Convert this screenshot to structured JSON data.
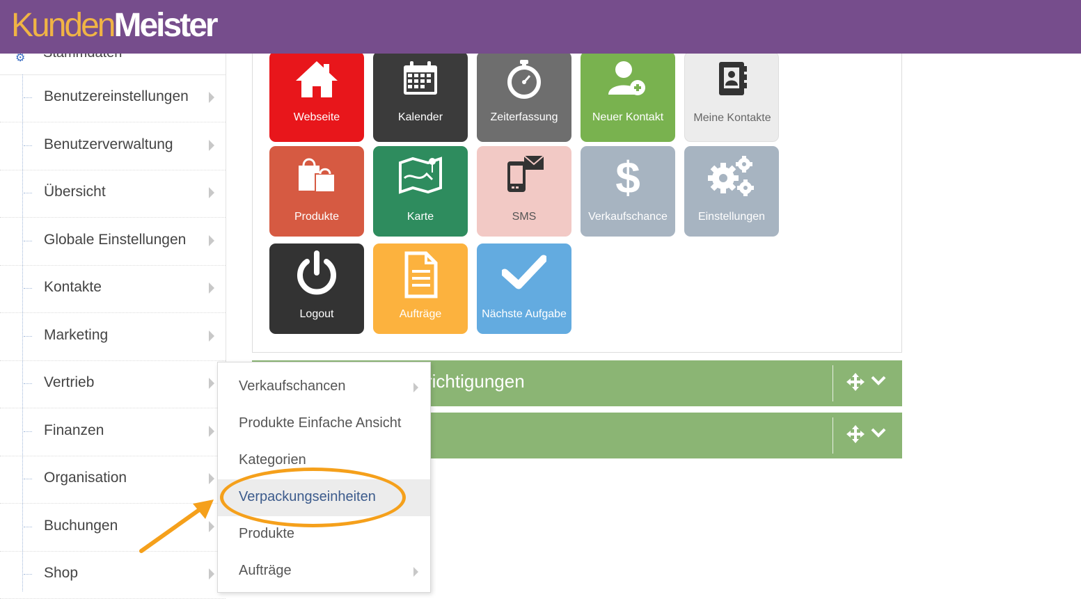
{
  "header": {
    "logo_part1": "Kunden",
    "logo_part2": "Meister",
    "background": "#764d8c",
    "logo_accent": "#f0b445"
  },
  "sidebar": {
    "stub_icon": "gears-icon",
    "stub_label": "Stammdaten",
    "items": [
      {
        "label": "Benutzereinstellungen",
        "has_submenu": true
      },
      {
        "label": "Benutzerverwaltung",
        "has_submenu": true
      },
      {
        "label": "Übersicht",
        "has_submenu": true
      },
      {
        "label": "Globale Einstellungen",
        "has_submenu": true
      },
      {
        "label": "Kontakte",
        "has_submenu": true
      },
      {
        "label": "Marketing",
        "has_submenu": true
      },
      {
        "label": "Vertrieb",
        "has_submenu": true
      },
      {
        "label": "Finanzen",
        "has_submenu": true
      },
      {
        "label": "Organisation",
        "has_submenu": true
      },
      {
        "label": "Buchungen",
        "has_submenu": true
      },
      {
        "label": "Shop",
        "has_submenu": true
      }
    ]
  },
  "tiles": [
    {
      "label": "Webseite",
      "icon": "home-icon",
      "color": "#e8161b"
    },
    {
      "label": "Kalender",
      "icon": "calendar-icon",
      "color": "#3b3b3b"
    },
    {
      "label": "Zeiterfassung",
      "icon": "stopwatch-icon",
      "color": "#6e6e6e"
    },
    {
      "label": "Neuer Kontakt",
      "icon": "add-user-icon",
      "color": "#79b24f"
    },
    {
      "label": "Meine Kontakte",
      "icon": "address-book-icon",
      "color": "#ececec"
    },
    {
      "label": "Produkte",
      "icon": "shopping-bags-icon",
      "color": "#d65a42"
    },
    {
      "label": "Karte",
      "icon": "map-icon",
      "color": "#2e8c5e"
    },
    {
      "label": "SMS",
      "icon": "phone-message-icon",
      "color": "#f2c9c5"
    },
    {
      "label": "Verkaufschance",
      "icon": "dollar-icon",
      "color": "#a7b4c1"
    },
    {
      "label": "Einstellungen",
      "icon": "gears-icon",
      "color": "#a7b4c1"
    },
    {
      "label": "Logout",
      "icon": "power-icon",
      "color": "#333333"
    },
    {
      "label": "Aufträge",
      "icon": "document-icon",
      "color": "#fcb23e"
    },
    {
      "label": "Nächste Aufgabe",
      "icon": "checkmark-icon",
      "color": "#63abe0"
    }
  ],
  "widgets": [
    {
      "title": "richtigungen",
      "move_icon": "move-icon",
      "toggle_icon": "chevron-down-icon"
    },
    {
      "title": "",
      "move_icon": "move-icon",
      "toggle_icon": "chevron-down-icon"
    }
  ],
  "widget_color": "#8bb574",
  "dropdown": {
    "items": [
      {
        "label": "Verkaufschancen",
        "has_submenu": true
      },
      {
        "label": "Produkte Einfache Ansicht",
        "has_submenu": false
      },
      {
        "label": "Kategorien",
        "has_submenu": false
      },
      {
        "label": "Verpackungseinheiten",
        "has_submenu": false,
        "highlighted": true
      },
      {
        "label": "Produkte",
        "has_submenu": false
      },
      {
        "label": "Aufträge",
        "has_submenu": true
      }
    ]
  },
  "annotation": {
    "color": "#f5a01b",
    "shapes": [
      "circle-highlight",
      "arrow-pointer"
    ]
  }
}
